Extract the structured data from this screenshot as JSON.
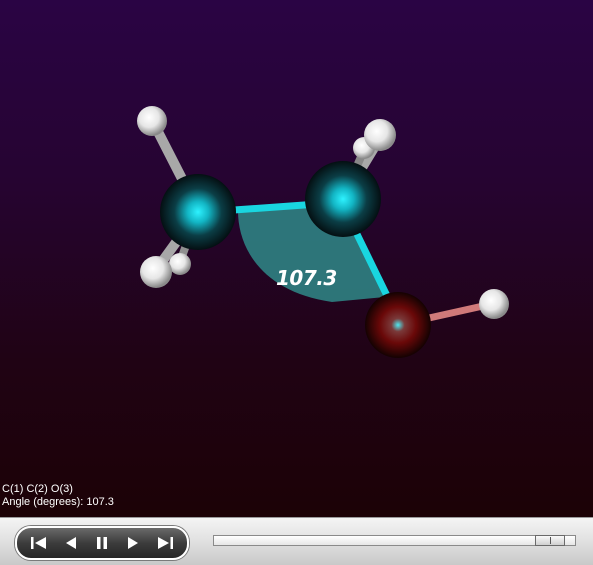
{
  "viewer": {
    "angle_label": "107.3",
    "readout": {
      "atoms_line": "C(1) C(2) O(3)",
      "angle_line": "Angle (degrees): 107.3"
    },
    "colors": {
      "background_top": "#2a0444",
      "background_bottom": "#1c0206",
      "carbon": "#12b5c4",
      "oxygen": "#b01010",
      "hydrogen": "#ffffff",
      "angle_arc": "#2f8585"
    }
  },
  "toolbar": {
    "buttons": [
      {
        "name": "skip-to-start-button",
        "icon": "skip-start-icon"
      },
      {
        "name": "step-back-button",
        "icon": "step-back-icon"
      },
      {
        "name": "pause-button",
        "icon": "pause-icon"
      },
      {
        "name": "play-button",
        "icon": "play-icon"
      },
      {
        "name": "skip-to-end-button",
        "icon": "skip-end-icon"
      }
    ],
    "progress_fraction": 0.97
  }
}
